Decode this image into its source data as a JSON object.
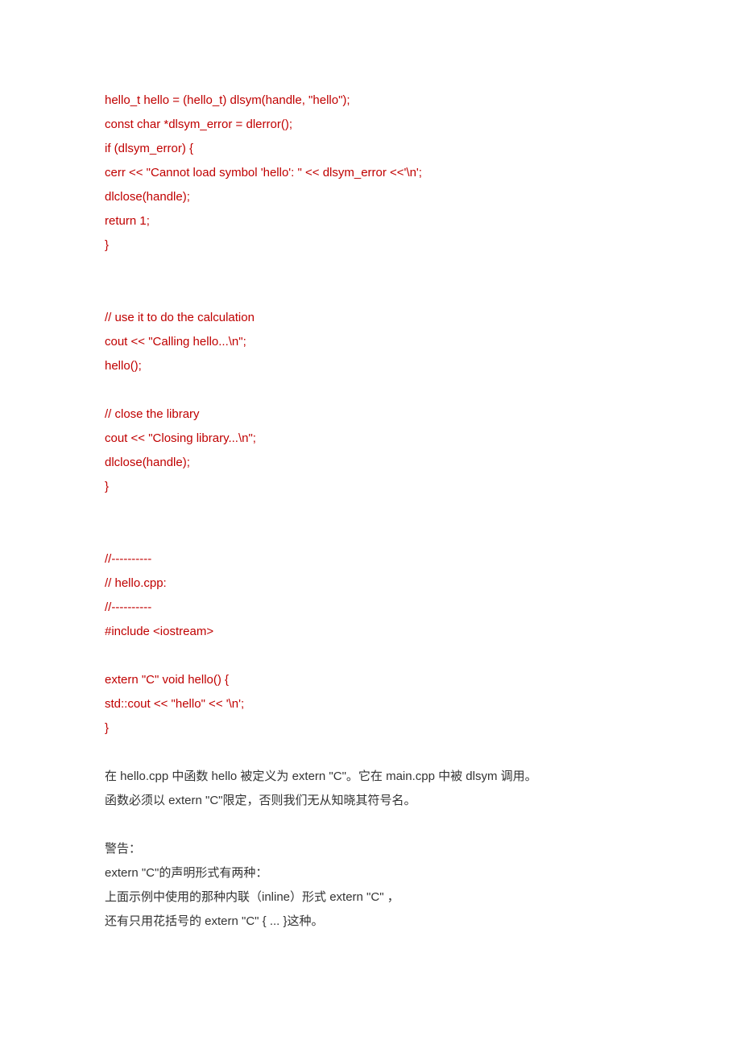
{
  "code": {
    "block1": [
      "hello_t hello = (hello_t) dlsym(handle, \"hello\");",
      "const char *dlsym_error = dlerror();",
      "if (dlsym_error) {",
      "cerr << \"Cannot load symbol 'hello': \" << dlsym_error <<'\\n';",
      "dlclose(handle);",
      "return 1;",
      "}"
    ],
    "block2": [
      "// use it to do the calculation",
      "cout << \"Calling hello...\\n\";",
      "hello();"
    ],
    "block3": [
      "// close the library",
      "cout << \"Closing library...\\n\";",
      "dlclose(handle);",
      "}"
    ],
    "block4": [
      "//----------",
      "// hello.cpp:",
      "//----------",
      "#include <iostream>"
    ],
    "block5": [
      "extern \"C\" void hello() {",
      "std::cout << \"hello\" << '\\n';",
      "}"
    ]
  },
  "text": {
    "para1": [
      "在 hello.cpp 中函数 hello 被定义为 extern \"C\"。它在 main.cpp 中被 dlsym 调用。",
      "函数必须以 extern \"C\"限定，否则我们无从知晓其符号名。"
    ],
    "para2": [
      "警告：",
      "extern \"C\"的声明形式有两种：",
      "上面示例中使用的那种内联（inline）形式 extern \"C\" ，",
      "还有只用花括号的 extern \"C\" { ... }这种。"
    ]
  }
}
